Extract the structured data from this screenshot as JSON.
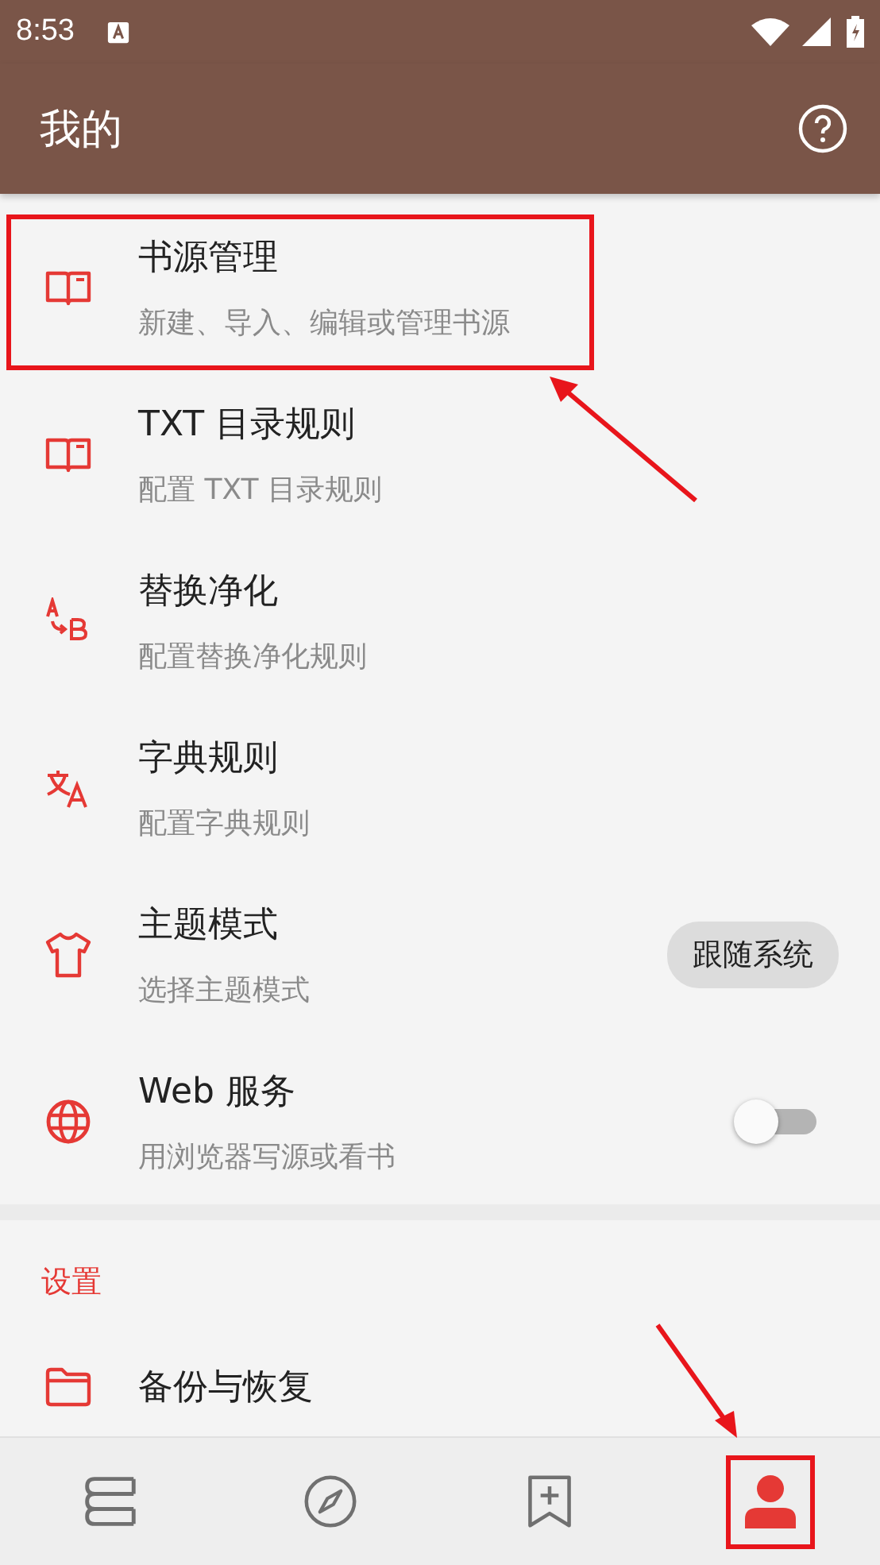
{
  "status_bar": {
    "time": "8:53"
  },
  "toolbar": {
    "title": "我的"
  },
  "items": [
    {
      "kind": "plain",
      "title": "书源管理",
      "subtitle": "新建、导入、编辑或管理书源",
      "highlighted": true
    },
    {
      "kind": "plain",
      "title": "TXT 目录规则",
      "subtitle": "配置 TXT 目录规则",
      "highlighted": false
    },
    {
      "kind": "plain",
      "title": "替换净化",
      "subtitle": "配置替换净化规则",
      "highlighted": false
    },
    {
      "kind": "plain",
      "title": "字典规则",
      "subtitle": "配置字典规则",
      "highlighted": false
    },
    {
      "kind": "chip",
      "title": "主题模式",
      "subtitle": "选择主题模式",
      "value": "跟随系统",
      "highlighted": false
    },
    {
      "kind": "switch",
      "title": "Web 服务",
      "subtitle": "用浏览器写源或看书",
      "on": false,
      "highlighted": false
    }
  ],
  "section": {
    "header": "设置",
    "items": [
      {
        "title": "备份与恢复"
      }
    ]
  },
  "bottom_nav": [
    {
      "selected": false,
      "highlighted": false
    },
    {
      "selected": false,
      "highlighted": false
    },
    {
      "selected": false,
      "highlighted": false
    },
    {
      "selected": true,
      "highlighted": true
    }
  ]
}
